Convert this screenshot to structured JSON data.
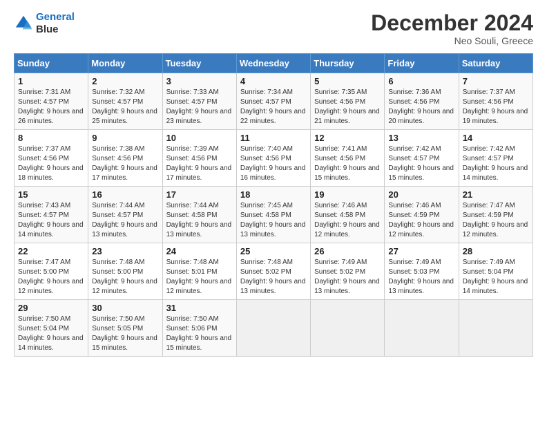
{
  "header": {
    "logo_line1": "General",
    "logo_line2": "Blue",
    "title": "December 2024",
    "subtitle": "Neo Souli, Greece"
  },
  "columns": [
    "Sunday",
    "Monday",
    "Tuesday",
    "Wednesday",
    "Thursday",
    "Friday",
    "Saturday"
  ],
  "weeks": [
    [
      {
        "day": "1",
        "sunrise": "7:31 AM",
        "sunset": "4:57 PM",
        "daylight": "9 hours and 26 minutes."
      },
      {
        "day": "2",
        "sunrise": "7:32 AM",
        "sunset": "4:57 PM",
        "daylight": "9 hours and 25 minutes."
      },
      {
        "day": "3",
        "sunrise": "7:33 AM",
        "sunset": "4:57 PM",
        "daylight": "9 hours and 23 minutes."
      },
      {
        "day": "4",
        "sunrise": "7:34 AM",
        "sunset": "4:57 PM",
        "daylight": "9 hours and 22 minutes."
      },
      {
        "day": "5",
        "sunrise": "7:35 AM",
        "sunset": "4:56 PM",
        "daylight": "9 hours and 21 minutes."
      },
      {
        "day": "6",
        "sunrise": "7:36 AM",
        "sunset": "4:56 PM",
        "daylight": "9 hours and 20 minutes."
      },
      {
        "day": "7",
        "sunrise": "7:37 AM",
        "sunset": "4:56 PM",
        "daylight": "9 hours and 19 minutes."
      }
    ],
    [
      {
        "day": "8",
        "sunrise": "7:37 AM",
        "sunset": "4:56 PM",
        "daylight": "9 hours and 18 minutes."
      },
      {
        "day": "9",
        "sunrise": "7:38 AM",
        "sunset": "4:56 PM",
        "daylight": "9 hours and 17 minutes."
      },
      {
        "day": "10",
        "sunrise": "7:39 AM",
        "sunset": "4:56 PM",
        "daylight": "9 hours and 17 minutes."
      },
      {
        "day": "11",
        "sunrise": "7:40 AM",
        "sunset": "4:56 PM",
        "daylight": "9 hours and 16 minutes."
      },
      {
        "day": "12",
        "sunrise": "7:41 AM",
        "sunset": "4:56 PM",
        "daylight": "9 hours and 15 minutes."
      },
      {
        "day": "13",
        "sunrise": "7:42 AM",
        "sunset": "4:57 PM",
        "daylight": "9 hours and 15 minutes."
      },
      {
        "day": "14",
        "sunrise": "7:42 AM",
        "sunset": "4:57 PM",
        "daylight": "9 hours and 14 minutes."
      }
    ],
    [
      {
        "day": "15",
        "sunrise": "7:43 AM",
        "sunset": "4:57 PM",
        "daylight": "9 hours and 14 minutes."
      },
      {
        "day": "16",
        "sunrise": "7:44 AM",
        "sunset": "4:57 PM",
        "daylight": "9 hours and 13 minutes."
      },
      {
        "day": "17",
        "sunrise": "7:44 AM",
        "sunset": "4:58 PM",
        "daylight": "9 hours and 13 minutes."
      },
      {
        "day": "18",
        "sunrise": "7:45 AM",
        "sunset": "4:58 PM",
        "daylight": "9 hours and 13 minutes."
      },
      {
        "day": "19",
        "sunrise": "7:46 AM",
        "sunset": "4:58 PM",
        "daylight": "9 hours and 12 minutes."
      },
      {
        "day": "20",
        "sunrise": "7:46 AM",
        "sunset": "4:59 PM",
        "daylight": "9 hours and 12 minutes."
      },
      {
        "day": "21",
        "sunrise": "7:47 AM",
        "sunset": "4:59 PM",
        "daylight": "9 hours and 12 minutes."
      }
    ],
    [
      {
        "day": "22",
        "sunrise": "7:47 AM",
        "sunset": "5:00 PM",
        "daylight": "9 hours and 12 minutes."
      },
      {
        "day": "23",
        "sunrise": "7:48 AM",
        "sunset": "5:00 PM",
        "daylight": "9 hours and 12 minutes."
      },
      {
        "day": "24",
        "sunrise": "7:48 AM",
        "sunset": "5:01 PM",
        "daylight": "9 hours and 12 minutes."
      },
      {
        "day": "25",
        "sunrise": "7:48 AM",
        "sunset": "5:02 PM",
        "daylight": "9 hours and 13 minutes."
      },
      {
        "day": "26",
        "sunrise": "7:49 AM",
        "sunset": "5:02 PM",
        "daylight": "9 hours and 13 minutes."
      },
      {
        "day": "27",
        "sunrise": "7:49 AM",
        "sunset": "5:03 PM",
        "daylight": "9 hours and 13 minutes."
      },
      {
        "day": "28",
        "sunrise": "7:49 AM",
        "sunset": "5:04 PM",
        "daylight": "9 hours and 14 minutes."
      }
    ],
    [
      {
        "day": "29",
        "sunrise": "7:50 AM",
        "sunset": "5:04 PM",
        "daylight": "9 hours and 14 minutes."
      },
      {
        "day": "30",
        "sunrise": "7:50 AM",
        "sunset": "5:05 PM",
        "daylight": "9 hours and 15 minutes."
      },
      {
        "day": "31",
        "sunrise": "7:50 AM",
        "sunset": "5:06 PM",
        "daylight": "9 hours and 15 minutes."
      },
      null,
      null,
      null,
      null
    ]
  ]
}
